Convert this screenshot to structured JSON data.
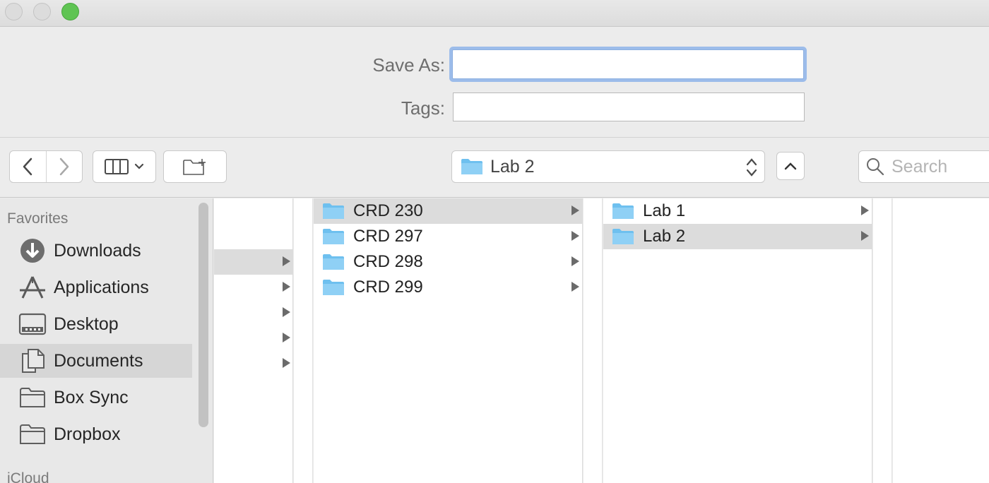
{
  "window": {
    "traffic_lights": [
      "close",
      "minimize",
      "zoom"
    ],
    "zoom_color": "#5fc453"
  },
  "save_panel": {
    "save_as_label": "Save As:",
    "save_as_value": "",
    "tags_label": "Tags:",
    "tags_value": ""
  },
  "toolbar": {
    "back_icon": "chevron-left-icon",
    "forward_icon": "chevron-right-icon",
    "view_icon": "column-view-icon",
    "new_folder_icon": "new-folder-icon",
    "location": "Lab 2",
    "search_placeholder": "Search"
  },
  "sidebar": {
    "favorites_heading": "Favorites",
    "items": [
      {
        "label": "Downloads",
        "icon": "download-icon",
        "selected": false
      },
      {
        "label": "Applications",
        "icon": "applications-icon",
        "selected": false
      },
      {
        "label": "Desktop",
        "icon": "desktop-icon",
        "selected": false
      },
      {
        "label": "Documents",
        "icon": "documents-icon",
        "selected": true
      },
      {
        "label": "Box Sync",
        "icon": "folder-icon",
        "selected": false
      },
      {
        "label": "Dropbox",
        "icon": "folder-icon",
        "selected": false
      }
    ],
    "icloud_heading": "iCloud"
  },
  "columns": {
    "col1_arrow_count": 5,
    "col1_selected_index": 0,
    "col2": [
      {
        "name": "CRD 230",
        "selected": true
      },
      {
        "name": "CRD 297",
        "selected": false
      },
      {
        "name": "CRD 298",
        "selected": false
      },
      {
        "name": "CRD 299",
        "selected": false
      }
    ],
    "col3": [
      {
        "name": "Lab 1",
        "selected": false
      },
      {
        "name": "Lab 2",
        "selected": true
      }
    ]
  },
  "colors": {
    "folder_blue": "#7ec8f2",
    "focus_ring": "#9cbcea",
    "selection_gray": "#dcdcdc"
  }
}
